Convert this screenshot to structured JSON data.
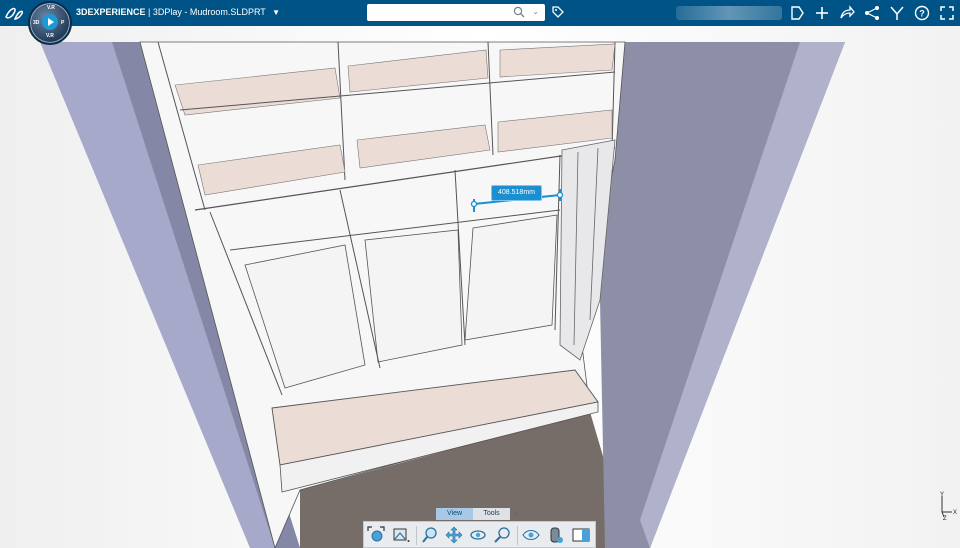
{
  "colors": {
    "topbar": "#005386",
    "accent": "#1a9ad6",
    "measure": "#1c8fd1"
  },
  "header": {
    "brand": "3DEXPERIENCE",
    "separator": "|",
    "app": "3DPlay - Mudroom.SLDPRT",
    "compass_top": "V.R",
    "compass_left": "3D",
    "compass_right": "P",
    "compass_bottom": "V.R",
    "search": {
      "value": "",
      "placeholder": ""
    },
    "actions": [
      "add-icon",
      "plus-icon",
      "share-icon",
      "network-icon",
      "tools-icon",
      "help-icon",
      "fullscreen-icon"
    ]
  },
  "viewport": {
    "measurement_label": "408.518mm",
    "axis_y": "Y",
    "axis_x": "X",
    "axis_z": "Z"
  },
  "tabs": [
    {
      "label": "View",
      "active": true
    },
    {
      "label": "Tools",
      "active": false
    }
  ],
  "toolbar": {
    "buttons": [
      "fit-all-icon",
      "view-mode-icon",
      "zoom-icon",
      "pan-icon",
      "rotate-icon",
      "zoom-area-icon",
      "look-at-icon",
      "section-icon",
      "display-icon"
    ]
  }
}
